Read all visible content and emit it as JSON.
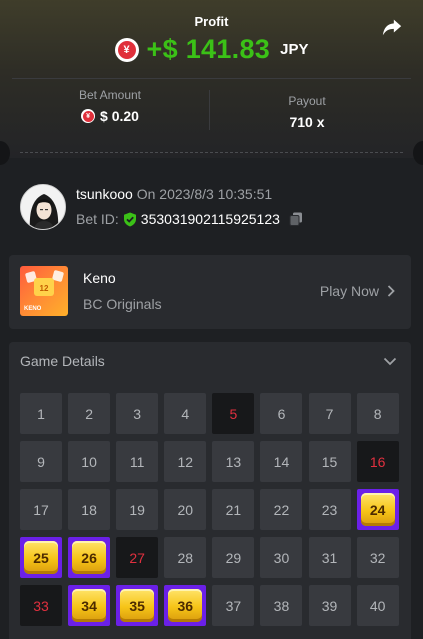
{
  "profit": {
    "title": "Profit",
    "coin_symbol": "¥",
    "amount": "+$ 141.83",
    "currency": "JPY"
  },
  "bet_amount": {
    "label": "Bet Amount",
    "value": "$ 0.20"
  },
  "payout": {
    "label": "Payout",
    "value": "710 x"
  },
  "user": {
    "name": "tsunkooo",
    "timestamp": "On 2023/8/3 10:35:51",
    "bet_id_label": "Bet ID:",
    "bet_id": "353031902115925123"
  },
  "game": {
    "name": "Keno",
    "provider": "BC Originals",
    "thumb_badge": "12",
    "thumb_label": "KENO",
    "play_label": "Play Now"
  },
  "details": {
    "title": "Game Details",
    "cells": [
      {
        "n": "1",
        "s": "normal"
      },
      {
        "n": "2",
        "s": "normal"
      },
      {
        "n": "3",
        "s": "normal"
      },
      {
        "n": "4",
        "s": "normal"
      },
      {
        "n": "5",
        "s": "miss"
      },
      {
        "n": "6",
        "s": "normal"
      },
      {
        "n": "7",
        "s": "normal"
      },
      {
        "n": "8",
        "s": "normal"
      },
      {
        "n": "9",
        "s": "normal"
      },
      {
        "n": "10",
        "s": "normal"
      },
      {
        "n": "11",
        "s": "normal"
      },
      {
        "n": "12",
        "s": "normal"
      },
      {
        "n": "13",
        "s": "normal"
      },
      {
        "n": "14",
        "s": "normal"
      },
      {
        "n": "15",
        "s": "normal"
      },
      {
        "n": "16",
        "s": "miss"
      },
      {
        "n": "17",
        "s": "normal"
      },
      {
        "n": "18",
        "s": "normal"
      },
      {
        "n": "19",
        "s": "normal"
      },
      {
        "n": "20",
        "s": "normal"
      },
      {
        "n": "21",
        "s": "normal"
      },
      {
        "n": "22",
        "s": "normal"
      },
      {
        "n": "23",
        "s": "normal"
      },
      {
        "n": "24",
        "s": "hit"
      },
      {
        "n": "25",
        "s": "hit"
      },
      {
        "n": "26",
        "s": "hit"
      },
      {
        "n": "27",
        "s": "miss"
      },
      {
        "n": "28",
        "s": "normal"
      },
      {
        "n": "29",
        "s": "normal"
      },
      {
        "n": "30",
        "s": "normal"
      },
      {
        "n": "31",
        "s": "normal"
      },
      {
        "n": "32",
        "s": "normal"
      },
      {
        "n": "33",
        "s": "miss"
      },
      {
        "n": "34",
        "s": "hit"
      },
      {
        "n": "35",
        "s": "hit"
      },
      {
        "n": "36",
        "s": "hit"
      },
      {
        "n": "37",
        "s": "normal"
      },
      {
        "n": "38",
        "s": "normal"
      },
      {
        "n": "39",
        "s": "normal"
      },
      {
        "n": "40",
        "s": "normal"
      }
    ]
  },
  "colors": {
    "profit_green": "#3bc117",
    "hit_purple": "#6b20e8",
    "miss_red": "#e1303f",
    "coin_red": "#e0303b"
  },
  "icons": {
    "share": "share-icon",
    "coin": "yen-coin-icon",
    "shield": "verified-shield-icon",
    "copy": "copy-icon",
    "chevron_right": "chevron-right-icon",
    "chevron_down": "chevron-down-icon"
  }
}
